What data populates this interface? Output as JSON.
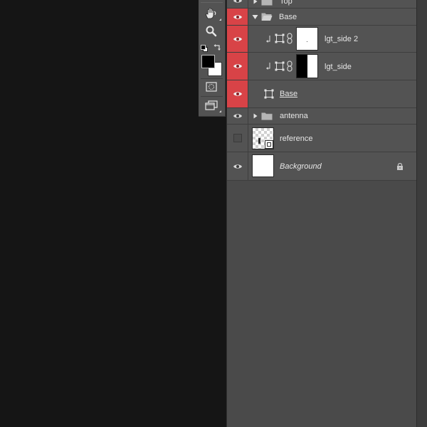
{
  "layers": {
    "rows": [
      {
        "name": "Top",
        "type": "group",
        "expanded": false,
        "visible": true,
        "highlighted": false
      },
      {
        "name": "Base",
        "type": "group",
        "expanded": true,
        "visible": true,
        "highlighted": true
      },
      {
        "name": "lgt_side 2",
        "type": "clipped-smart-layer",
        "visible": true,
        "highlighted": true
      },
      {
        "name": "lgt_side",
        "type": "clipped-smart-layer",
        "visible": true,
        "highlighted": true
      },
      {
        "name": "Base",
        "type": "smart-object",
        "visible": true,
        "highlighted": true,
        "underlined": true
      },
      {
        "name": "antenna",
        "type": "group",
        "expanded": false,
        "visible": true,
        "highlighted": false
      },
      {
        "name": "reference",
        "type": "smart-object",
        "visible": false,
        "highlighted": false
      },
      {
        "name": "Background",
        "type": "background",
        "visible": true,
        "highlighted": false,
        "locked": true
      }
    ]
  },
  "tools": [
    "hand-tool",
    "zoom-tool",
    "default-colors",
    "swap-colors",
    "foreground-color",
    "background-color",
    "quick-mask",
    "screen-mode"
  ],
  "colors": {
    "visibility_highlight": "#d84347",
    "foreground": "#000000",
    "background": "#ffffff",
    "panel": "#535353"
  }
}
